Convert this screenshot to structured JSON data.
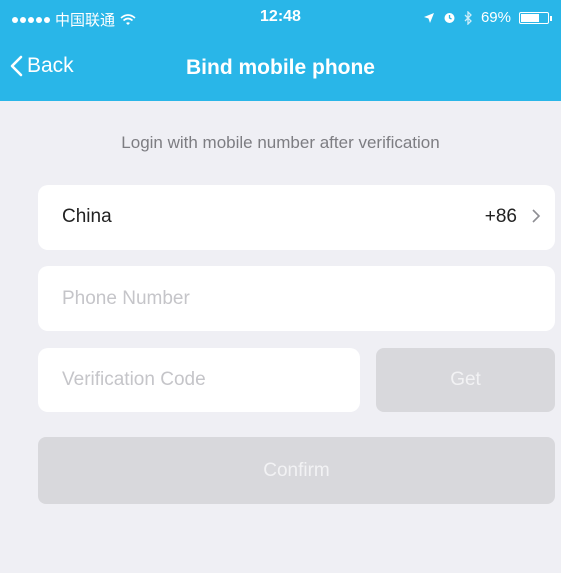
{
  "status_bar": {
    "carrier": "中国联通",
    "time": "12:48",
    "battery": "69%",
    "battery_level": 0.69
  },
  "navbar": {
    "back_label": "Back",
    "title": "Bind mobile phone"
  },
  "form": {
    "hint": "Login with mobile number after verification",
    "country_name": "China",
    "country_code": "+86",
    "phone_placeholder": "Phone Number",
    "code_placeholder": "Verification Code",
    "get_label": "Get",
    "confirm_label": "Confirm"
  },
  "colors": {
    "header": "#29b6e8",
    "background": "#efeff4",
    "disabled_button": "#d8d8dc"
  }
}
